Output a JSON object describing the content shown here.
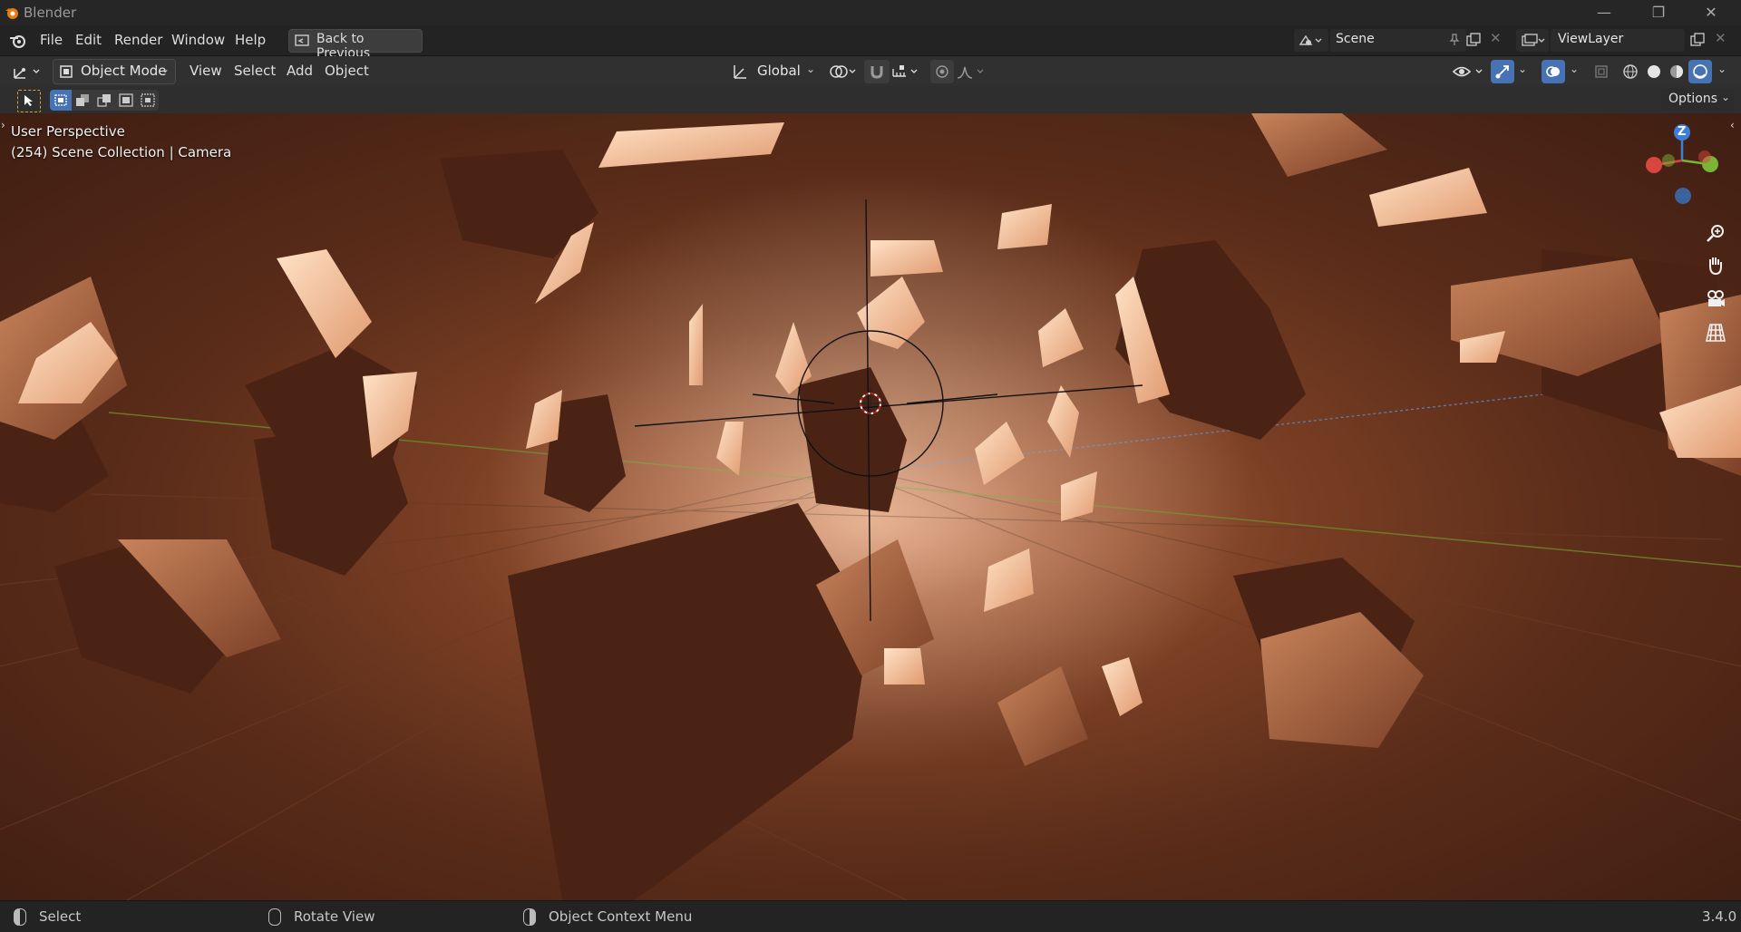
{
  "window": {
    "title": "Blender",
    "minimize": "—",
    "restore": "❐",
    "close": "✕"
  },
  "menubar": {
    "items": [
      "File",
      "Edit",
      "Render",
      "Window",
      "Help"
    ],
    "back_button": "Back to Previous",
    "scene": {
      "label": "Scene"
    },
    "view_layer": {
      "label": "ViewLayer"
    }
  },
  "header": {
    "mode": "Object Mode",
    "menus": [
      "View",
      "Select",
      "Add",
      "Object"
    ],
    "transform_orientation": "Global",
    "options": "Options"
  },
  "viewport": {
    "perspective": "User Perspective",
    "collection_info": "(254) Scene Collection | Camera",
    "gizmo_axis_label": "Z"
  },
  "statusbar": {
    "select": "Select",
    "rotate": "Rotate View",
    "context_menu": "Object Context Menu",
    "version": "3.4.0"
  },
  "colors": {
    "accent_blue": "#4772b3",
    "axis_x": "#d9463f",
    "axis_y": "#7bb334",
    "axis_z": "#3b7fd9",
    "rock_lit": "#f3c7a3",
    "rock_dark": "#4a2315"
  }
}
